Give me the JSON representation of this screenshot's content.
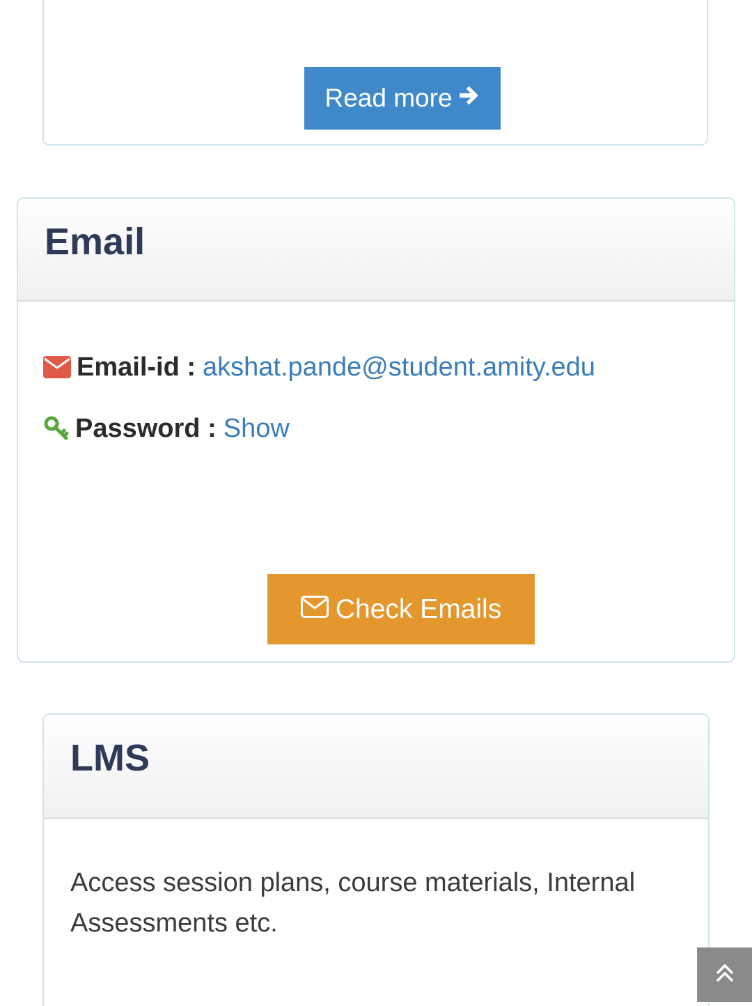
{
  "top_card": {
    "read_more_label": "Read more"
  },
  "email_card": {
    "title": "Email",
    "email_label": "Email-id :",
    "email_value": "akshat.pande@student.amity.edu",
    "password_label": "Password :",
    "password_action": "Show",
    "check_emails_label": "Check Emails"
  },
  "lms_card": {
    "title": "LMS",
    "description": "Access session plans, course materials, Internal Assessments etc."
  },
  "icons": {
    "read_more": "arrow-right-icon",
    "email": "envelope-icon",
    "password": "key-icon",
    "check_emails": "envelope-icon",
    "scroll_top": "double-chevron-up-icon"
  },
  "colors": {
    "primary_button": "#3f89cb",
    "warning_button": "#e4972d",
    "link": "#3a7db8",
    "title": "#2f3a58",
    "envelope_icon": "#e05a47",
    "key_icon": "#5aa63c",
    "card_border": "#cfe6ea",
    "scroll_top_bg": "#8a8a8a"
  }
}
